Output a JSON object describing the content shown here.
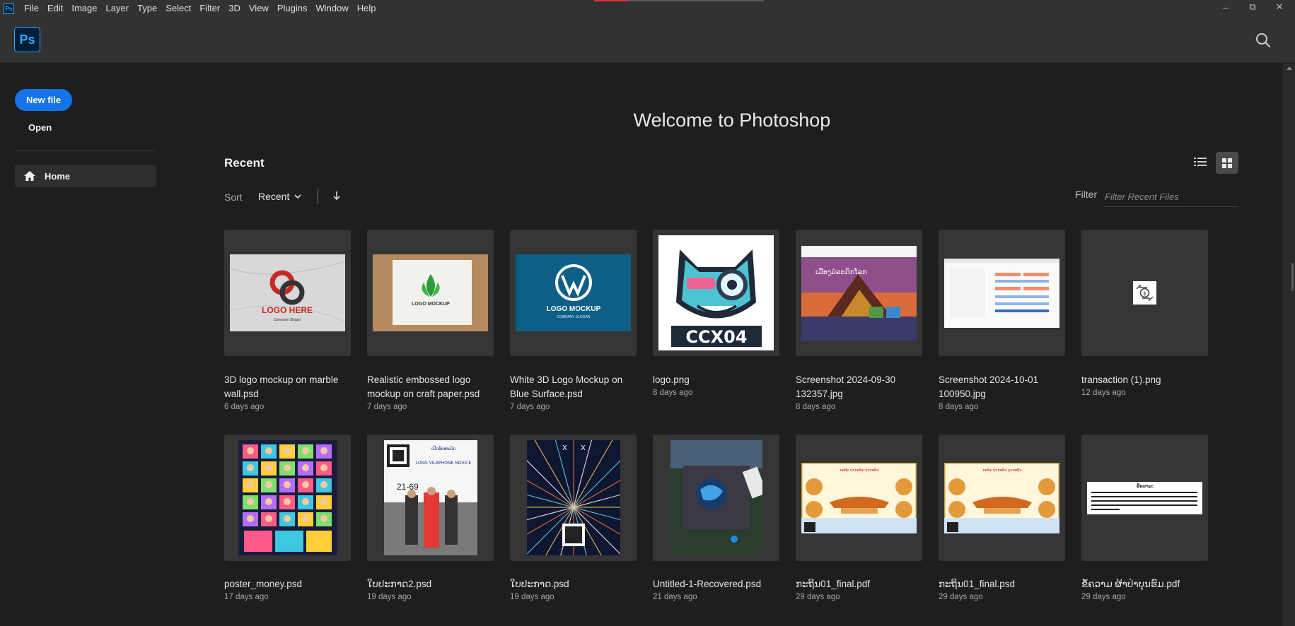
{
  "menubar": {
    "app_icon": "Ps",
    "items": [
      "File",
      "Edit",
      "Image",
      "Layer",
      "Type",
      "Select",
      "Filter",
      "3D",
      "View",
      "Plugins",
      "Window",
      "Help"
    ]
  },
  "window_controls": {
    "minimize": "–",
    "restore": "⧉",
    "close": "✕"
  },
  "header": {
    "logo": "Ps",
    "search_icon": "search-icon"
  },
  "sidebar": {
    "new_file": "New file",
    "open": "Open",
    "home": "Home"
  },
  "main": {
    "welcome": "Welcome to Photoshop",
    "recent_title": "Recent",
    "sort_label": "Sort",
    "sort_value": "Recent",
    "filter_label": "Filter",
    "filter_placeholder": "Filter Recent Files"
  },
  "files": [
    {
      "name": "3D logo mockup on marble wall.psd",
      "date": "6 days ago",
      "thumb": "marble"
    },
    {
      "name": "Realistic embossed logo mockup on craft paper.psd",
      "date": "7 days ago",
      "thumb": "craft"
    },
    {
      "name": "White 3D Logo Mockup on Blue Surface.psd",
      "date": "7 days ago",
      "thumb": "blue"
    },
    {
      "name": "logo.png",
      "date": "8 days ago",
      "thumb": "cat"
    },
    {
      "name": "Screenshot 2024-09-30 132357.jpg",
      "date": "8 days ago",
      "thumb": "temple"
    },
    {
      "name": "Screenshot 2024-10-01 100950.jpg",
      "date": "8 days ago",
      "thumb": "sheet"
    },
    {
      "name": "transaction (1).png",
      "date": "12 days ago",
      "thumb": "transaction"
    },
    {
      "name": "poster_money.psd",
      "date": "17 days ago",
      "thumb": "poster"
    },
    {
      "name": "ໃບປະກາດ2.psd",
      "date": "19 days ago",
      "thumb": "monks"
    },
    {
      "name": "ໃບປະກາດ.psd",
      "date": "19 days ago",
      "thumb": "lights"
    },
    {
      "name": "Untitled-1-Recovered.psd",
      "date": "21 days ago",
      "thumb": "globe"
    },
    {
      "name": "ກະຖິນ01_final.pdf",
      "date": "29 days ago",
      "thumb": "banner"
    },
    {
      "name": "ກະຖິນ01_final.psd",
      "date": "29 days ago",
      "thumb": "banner"
    },
    {
      "name": "ຂໍ້ຄວາມ ຜ້າປ່າບຸນຮົມ.pdf",
      "date": "29 days ago",
      "thumb": "textdoc"
    }
  ],
  "colors": {
    "accent": "#1473e6",
    "ps_blue": "#31a8ff",
    "background": "#1e1e1e",
    "chrome": "#323232"
  }
}
